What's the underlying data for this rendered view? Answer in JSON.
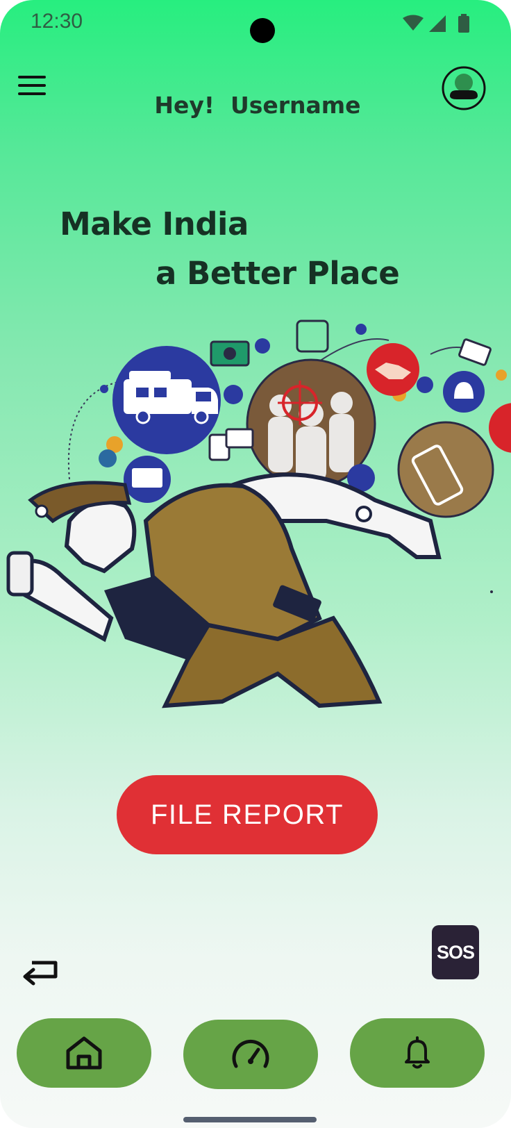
{
  "status_bar": {
    "time": "12:30",
    "icons": [
      "wifi-icon",
      "signal-icon",
      "battery-icon"
    ]
  },
  "header": {
    "greeting": "Hey!  Username",
    "menu_icon": "hamburger-menu-icon",
    "profile_icon": "user-avatar-icon"
  },
  "hero": {
    "line1": "Make India",
    "line2": "a Better Place"
  },
  "illustration": {
    "subject": "police-officer-illustration"
  },
  "actions": {
    "file_report_label": "FILE REPORT",
    "sos_label": "SOS",
    "back_icon": "return-arrow-icon"
  },
  "bottom_nav": {
    "items": [
      {
        "id": "home",
        "icon": "home-icon"
      },
      {
        "id": "dashboard",
        "icon": "speedometer-icon"
      },
      {
        "id": "notifications",
        "icon": "bell-icon"
      }
    ]
  },
  "colors": {
    "gradient_top": "#27ee7f",
    "gradient_bottom": "#f6f9f7",
    "file_report_button": "#e03035",
    "nav_pill": "#66a447",
    "sos_button": "#2a2236",
    "heading_text": "#163124"
  }
}
